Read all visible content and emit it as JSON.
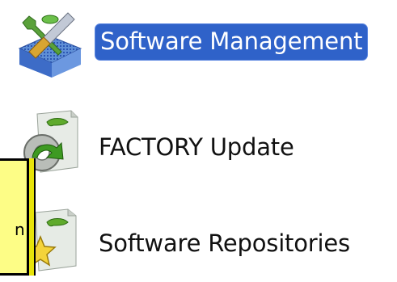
{
  "items": [
    {
      "label": "Software Management",
      "icon": "software-management-icon",
      "selected": true
    },
    {
      "label": "FACTORY Update",
      "icon": "factory-update-icon",
      "selected": false
    },
    {
      "label": "Software Repositories",
      "icon": "software-repositories-icon",
      "selected": false
    }
  ],
  "tooltip": {
    "text": "n"
  },
  "colors": {
    "selection": "#2f62c9",
    "tooltip_bg": "#fdfd86",
    "accent_green": "#5faa2c"
  }
}
